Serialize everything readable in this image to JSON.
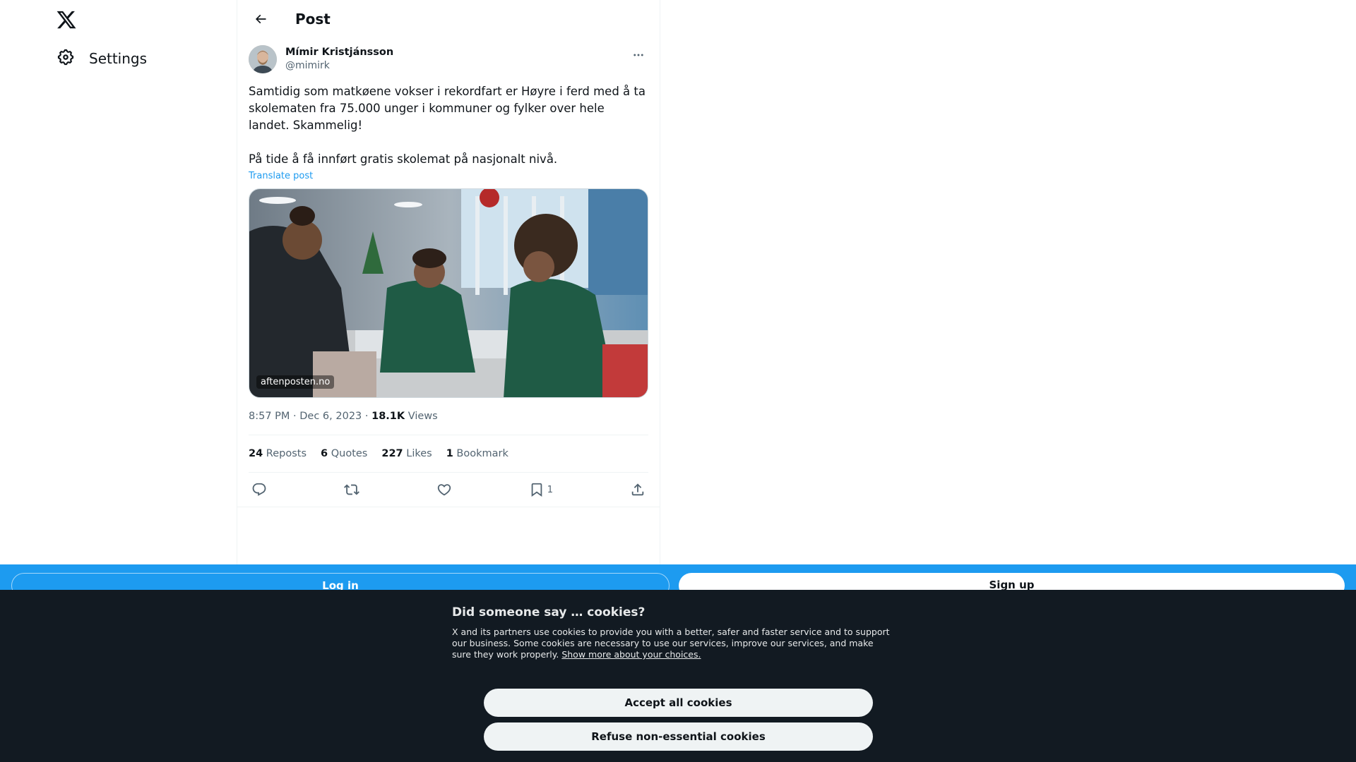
{
  "nav": {
    "settings_label": "Settings"
  },
  "header": {
    "title": "Post"
  },
  "post": {
    "display_name": "Mímir Kristjánsson",
    "handle": "@mimirk",
    "text": "Samtidig som matkøene vokser i rekordfart er Høyre i ferd med å ta skolematen fra 75.000 unger i kommuner og fylker over hele landet. Skammelig!\n\nPå tide å få innført gratis skolemat på nasjonalt nivå.",
    "translate_label": "Translate post",
    "media_source": "aftenposten.no",
    "time": "8:57 PM",
    "separator": "·",
    "date": "Dec 6, 2023",
    "views_count": "18.1K",
    "views_label": "Views"
  },
  "stats": {
    "reposts_count": "24",
    "reposts_label": "Reposts",
    "quotes_count": "6",
    "quotes_label": "Quotes",
    "likes_count": "227",
    "likes_label": "Likes",
    "bookmarks_count": "1",
    "bookmarks_label": "Bookmark"
  },
  "actions": {
    "bookmark_count": "1",
    "icons": [
      "reply-icon",
      "repost-icon",
      "like-icon",
      "bookmark-icon",
      "share-icon"
    ]
  },
  "bottom_bar": {
    "login_label": "Log in",
    "signup_label": "Sign up"
  },
  "cookies": {
    "title": "Did someone say … cookies?",
    "body": "X and its partners use cookies to provide you with a better, safer and faster service and to support our business. Some cookies are necessary to use our services, improve our services, and make sure they work properly.",
    "link": "Show more about your choices.",
    "accept_label": "Accept all cookies",
    "refuse_label": "Refuse non-essential cookies"
  },
  "colors": {
    "accent": "#1d9bf0",
    "banner_bg": "#121a22",
    "text_primary": "#0f1419",
    "text_secondary": "#536471"
  }
}
